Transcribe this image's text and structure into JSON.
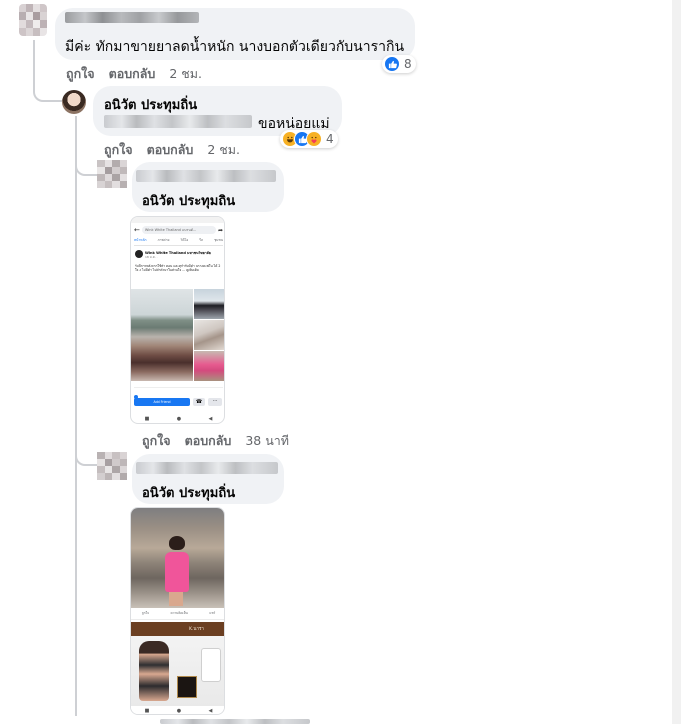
{
  "comment1": {
    "name": "Saskhorn Kwanhiyana",
    "text": "มีค่ะ ทักมาขายยาลดน้ำหนัก นางบอกตัวเดียวกับนารากิน",
    "like_label": "ถูกใจ",
    "reply_label": "ตอบกลับ",
    "time": "2 ชม.",
    "reaction_count": "8",
    "reaction_icons": [
      "like-icon"
    ]
  },
  "comment2": {
    "name": "อนิวัต ประทุมถิ่น",
    "text": "ขอหน่อยแม่",
    "like_label": "ถูกใจ",
    "reply_label": "ตอบกลับ",
    "time": "2 ชม.",
    "reaction_count": "4",
    "reaction_icons": [
      "haha-icon",
      "wow-icon",
      "care-icon"
    ]
  },
  "comment3": {
    "mention": "อนิวัต ประทุมถิน",
    "like_label": "ถูกใจ",
    "reply_label": "ตอบกลับ",
    "time": "38 นาที",
    "screenshot": {
      "search_text": "Wink White Thailand แบรนด์...",
      "tabs": [
        "หน้าหลัก",
        "ภาพถ่าย",
        "วิดีโอ",
        "รีล",
        "ชุมชน",
        "ร้านค้า"
      ],
      "page_name": "Wink White Thailand มหาชนวิทยาลัย",
      "page_meta": "18 ม.ค. · ",
      "post_text": "รับปีการหลังจากใช้ทำ ตอน และทุกำกับมีคำ นรางคะพ่ใน ได้ 2 ใจ ง ไม่มีคำ ไม่คำตัวมาในส่วนใจ ... ดูเพิ่มเติม",
      "send_label": "Add Friend"
    }
  },
  "comment4": {
    "mention": "อนิวัต ประทุมถิ่น",
    "screenshot": {
      "bottom_bar_left": "ถูกใจ",
      "bottom_bar_mid": "ความคิดเห็น",
      "bottom_bar_right": "แชร์",
      "brand_label": "K.นารา"
    }
  },
  "colors": {
    "bubble": "#f0f2f5",
    "secondary_text": "#65676b",
    "like_blue": "#1877f2",
    "thread_line": "#ced0d4"
  }
}
